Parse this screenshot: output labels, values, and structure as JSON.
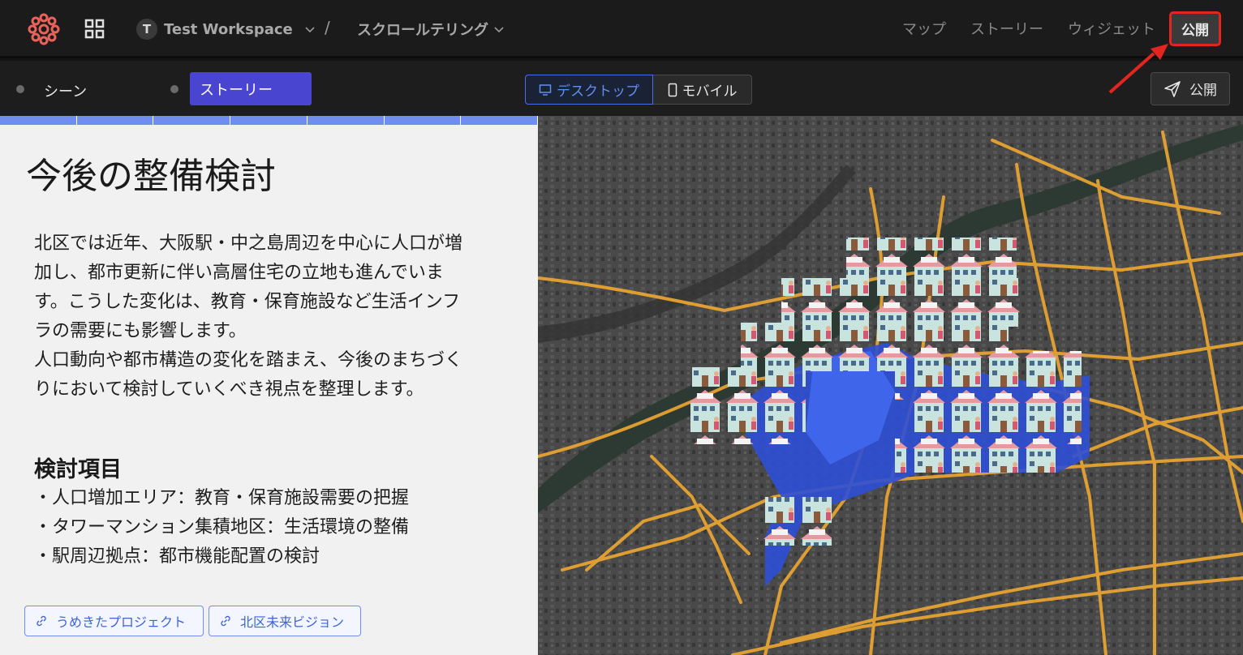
{
  "header": {
    "workspace_initial": "T",
    "workspace_name": "Test Workspace",
    "separator": "/",
    "project_name": "スクロールテリング",
    "nav": [
      "マップ",
      "ストーリー",
      "ウィジェット"
    ],
    "publish_label": "公開"
  },
  "subbar": {
    "scene_label": "シーン",
    "story_label": "ストーリー",
    "desktop_label": "デスクトップ",
    "mobile_label": "モバイル",
    "publish_label": "公開"
  },
  "panel": {
    "title": "今後の整備検討",
    "paragraph_lines": [
      "北区では近年、大阪駅・中之島周辺を中心に人口が増",
      "加し、都市更新に伴い高層住宅の立地も進んでいま",
      "す。こうした変化は、教育・保育施設など生活インフ",
      "ラの需要にも影響します。",
      "人口動向や都市構造の変化を踏まえ、今後のまちづく",
      "りにおいて検討していくべき視点を整理します。"
    ],
    "subheading": "検討項目",
    "items": [
      "・人口増加エリア：教育・保育施設需要の把握",
      "・タワーマンション集積地区：生活環境の整備",
      "・駅周辺拠点：都市機能配置の検討"
    ],
    "links": [
      "うめきたプロジェクト",
      "北区未来ビジョン"
    ]
  },
  "colors": {
    "accent": "#4a45d0",
    "highlight": "#e2261f",
    "road": "#f0a830",
    "area": "#2d4fd6"
  }
}
